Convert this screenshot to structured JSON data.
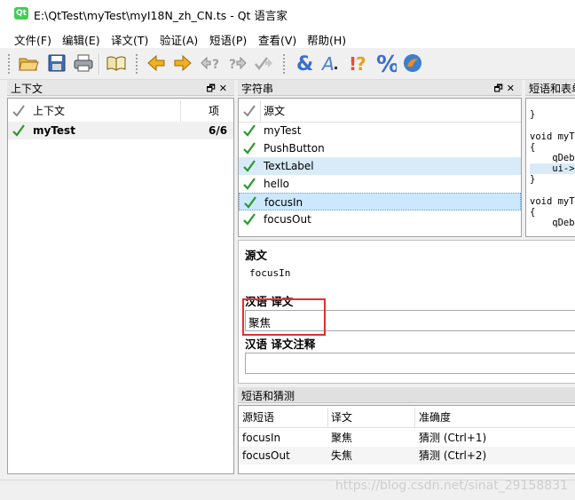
{
  "window": {
    "title": "E:\\QtTest\\myTest\\myI18N_zh_CN.ts - Qt 语言家",
    "app_icon": "qt-logo-icon"
  },
  "menu": [
    "文件(F)",
    "编辑(E)",
    "译文(T)",
    "验证(A)",
    "短语(P)",
    "查看(V)",
    "帮助(H)"
  ],
  "toolbar": {
    "icons": [
      "open-folder-icon",
      "save-icon",
      "print-icon",
      "book-icon",
      "arrow-left-icon",
      "arrow-right-icon",
      "prev-unfinished-icon",
      "next-unfinished-icon",
      "done-next-icon",
      "accelerator-check-icon",
      "punctuation-check-icon",
      "phrase-match-icon",
      "placemarker-check-icon",
      "surrounding-whitespace-icon"
    ]
  },
  "context_dock": {
    "title": "上下文",
    "columns": [
      "上下文",
      "项"
    ],
    "rows": [
      {
        "name": "myTest",
        "count": "6/6",
        "status": "done"
      }
    ]
  },
  "strings_dock": {
    "title": "字符串",
    "column": "源文",
    "rows": [
      {
        "text": "myTest",
        "status": "done"
      },
      {
        "text": "PushButton",
        "status": "done"
      },
      {
        "text": "TextLabel",
        "status": "done"
      },
      {
        "text": "hello",
        "status": "done"
      },
      {
        "text": "focusIn",
        "status": "done"
      },
      {
        "text": "focusOut",
        "status": "done"
      }
    ],
    "selected_index": 4
  },
  "sources_dock": {
    "title": "短语和表单",
    "code_lines": [
      "}",
      "",
      "void myTe",
      "{",
      "    qDebu",
      "    ui->t",
      "}",
      "",
      "void myTe",
      "{",
      "    qDebu"
    ]
  },
  "editor": {
    "source_label": "源文",
    "source_text": "focusIn",
    "translation_label": "汉语 译文",
    "translation_value": "聚焦",
    "comment_label": "汉语 译文注释",
    "comment_value": ""
  },
  "phrases_dock": {
    "title": "短语和猜测",
    "columns": [
      "源短语",
      "译文",
      "准确度"
    ],
    "rows": [
      {
        "source": "focusIn",
        "translation": "聚焦",
        "accuracy": "猜测 (Ctrl+1)"
      },
      {
        "source": "focusOut",
        "translation": "失焦",
        "accuracy": "猜测 (Ctrl+2)"
      }
    ]
  },
  "watermark": "https://blog.csdn.net/sinat_29158831",
  "colors": {
    "highlight": "#d9ebf9",
    "selected": "#cce8ff",
    "check": "#2a9a2a",
    "annotation": "#e03030"
  }
}
